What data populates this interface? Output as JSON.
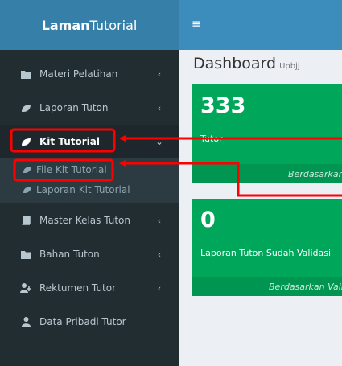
{
  "header": {
    "logo_bold": "Laman",
    "logo_light": "Tutorial",
    "toggle_icon": "hamburger-icon"
  },
  "sidebar": {
    "items": [
      {
        "label": "Materi Pelatihan",
        "icon": "folder-icon",
        "chevron": "‹"
      },
      {
        "label": "Laporan Tuton",
        "icon": "leaf-icon",
        "chevron": "‹"
      },
      {
        "label": "Kit Tutorial",
        "icon": "leaf-icon",
        "chevron": "⌄"
      },
      {
        "label": "Master Kelas Tuton",
        "icon": "book-icon",
        "chevron": "‹"
      },
      {
        "label": "Bahan Tuton",
        "icon": "folder-icon",
        "chevron": "‹"
      },
      {
        "label": "Rektumen Tutor",
        "icon": "user-plus-icon",
        "chevron": "‹"
      },
      {
        "label": "Data Pribadi Tutor",
        "icon": "user-icon",
        "chevron": ""
      }
    ],
    "submenu": [
      {
        "label": "File Kit Tutorial",
        "icon": "leaf-icon"
      },
      {
        "label": "Laporan Kit Tutorial",
        "icon": "leaf-icon"
      }
    ]
  },
  "content": {
    "title": "Dashboard",
    "subtitle": "Upbjj",
    "boxes": [
      {
        "value": "333",
        "label": "Tutor",
        "footer": "Berdasarkan"
      },
      {
        "value": "0",
        "label": "Laporan Tuton Sudah Validasi",
        "footer": "Berdasarkan Validasi"
      }
    ]
  },
  "colors": {
    "annotation": "#ff0000",
    "box_green": "#00a65a",
    "sidebar_bg": "#222d32",
    "header_bg": "#3c8dbc"
  }
}
